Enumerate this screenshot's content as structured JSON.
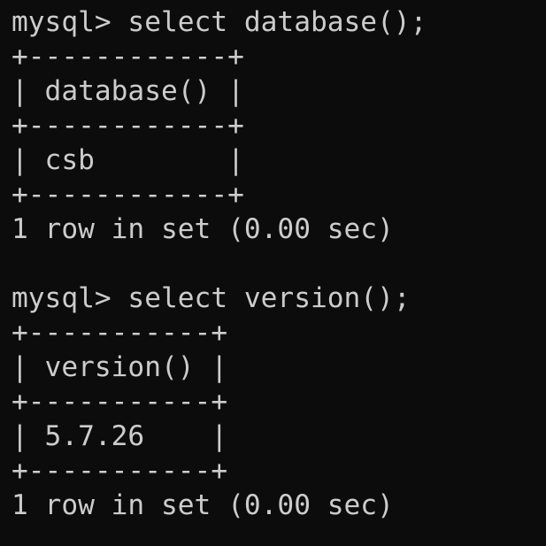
{
  "terminal": {
    "session1": {
      "prompt_command": "mysql> select database();",
      "border_top": "+------------+",
      "header_row": "| database() |",
      "border_mid": "+------------+",
      "data_row": "| csb        |",
      "border_bottom": "+------------+",
      "result_summary": "1 row in set (0.00 sec)"
    },
    "session2": {
      "prompt_command": "mysql> select version();",
      "border_top": "+-----------+",
      "header_row": "| version() |",
      "border_mid": "+-----------+",
      "data_row": "| 5.7.26    |",
      "border_bottom": "+-----------+",
      "result_summary": "1 row in set (0.00 sec)"
    }
  }
}
